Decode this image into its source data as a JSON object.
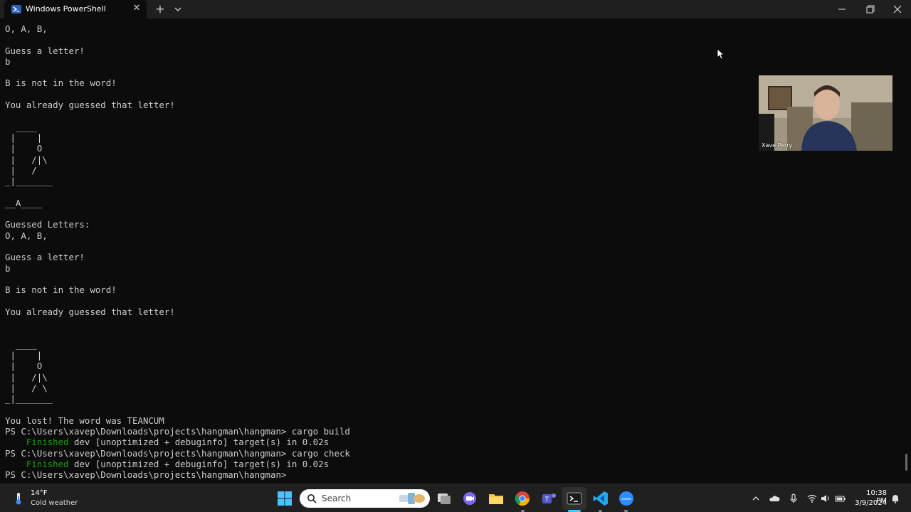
{
  "window": {
    "tab_title": "Windows PowerShell",
    "tab_close": "✕",
    "new_tab": "+"
  },
  "terminal": {
    "lines": [
      {
        "text": "O, A, B,"
      },
      {
        "text": ""
      },
      {
        "text": "Guess a letter!"
      },
      {
        "text": "b"
      },
      {
        "text": ""
      },
      {
        "text": "B is not in the word!"
      },
      {
        "text": ""
      },
      {
        "text": "You already guessed that letter!"
      },
      {
        "text": ""
      },
      {
        "text": "  ____"
      },
      {
        "text": " |    |"
      },
      {
        "text": " |    O"
      },
      {
        "text": " |   /|\\"
      },
      {
        "text": " |   /"
      },
      {
        "text": "_|_______"
      },
      {
        "text": ""
      },
      {
        "text": "__A____"
      },
      {
        "text": ""
      },
      {
        "text": "Guessed Letters:"
      },
      {
        "text": "O, A, B,"
      },
      {
        "text": ""
      },
      {
        "text": "Guess a letter!"
      },
      {
        "text": "b"
      },
      {
        "text": ""
      },
      {
        "text": "B is not in the word!"
      },
      {
        "text": ""
      },
      {
        "text": "You already guessed that letter!"
      },
      {
        "text": ""
      },
      {
        "text": ""
      },
      {
        "text": "  ____"
      },
      {
        "text": " |    |"
      },
      {
        "text": " |    O"
      },
      {
        "text": " |   /|\\"
      },
      {
        "text": " |   / \\"
      },
      {
        "text": "_|_______"
      },
      {
        "text": ""
      },
      {
        "text": "You lost! The word was TEANCUM"
      },
      {
        "text": "PS C:\\Users\\xavep\\Downloads\\projects\\hangman\\hangman> cargo build"
      },
      {
        "indent": "    ",
        "green": "Finished",
        "text": " dev [unoptimized + debuginfo] target(s) in 0.02s"
      },
      {
        "text": "PS C:\\Users\\xavep\\Downloads\\projects\\hangman\\hangman> cargo check"
      },
      {
        "indent": "    ",
        "green": "Finished",
        "text": " dev [unoptimized + debuginfo] target(s) in 0.02s"
      },
      {
        "text": "PS C:\\Users\\xavep\\Downloads\\projects\\hangman\\hangman>"
      }
    ]
  },
  "webcam": {
    "participant_name": "Xave Perry"
  },
  "taskbar": {
    "weather_temp": "14°F",
    "weather_desc": "Cold weather",
    "search_label": "Search",
    "clock_time": "10:38 PM",
    "clock_date": "3/9/2024",
    "accent_color": "#4cc2ff"
  }
}
